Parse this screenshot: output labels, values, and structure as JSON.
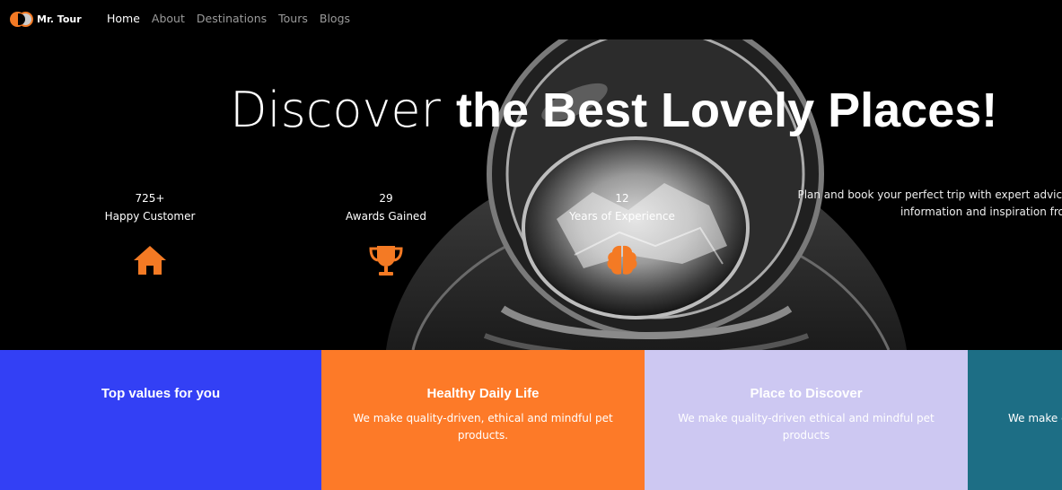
{
  "nav": {
    "brand": "Mr. Tour",
    "items": [
      "Home",
      "About",
      "Destinations",
      "Tours",
      "Blogs"
    ]
  },
  "hero": {
    "headline_light": "Discover",
    "headline_bold": "the Best Lovely Places!",
    "stats": [
      {
        "value": "725+",
        "label": "Happy Customer",
        "icon": "home-icon"
      },
      {
        "value": "29",
        "label": "Awards Gained",
        "icon": "trophy-icon"
      },
      {
        "value": "12",
        "label": "Years of Experience",
        "icon": "brain-icon"
      }
    ],
    "tagline": "Plan and book your perfect trip with expert advice, travel tips, destination information and inspiration from us."
  },
  "cards": [
    {
      "title": "Top values for you",
      "desc": "",
      "color": "#3340f5"
    },
    {
      "title": "Healthy Daily Life",
      "desc": "We make quality-driven, ethical and mindful pet products.",
      "color": "#fd7a28"
    },
    {
      "title": "Place to Discover",
      "desc": "We make quality-driven ethical and mindful pet products",
      "color": "#cdc8f2"
    },
    {
      "title": "",
      "desc": "We make quality-driven ethical and mindful pet products",
      "color": "#1d6e85"
    }
  ],
  "colors": {
    "accent": "#f47a24"
  }
}
